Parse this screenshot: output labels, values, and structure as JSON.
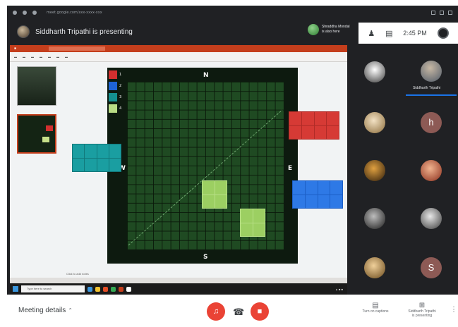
{
  "browser": {
    "url": "meet.google.com/xxx-xxxx-xxx"
  },
  "header": {
    "presenting_text": "Siddharth Tripathi is presenting",
    "joiner_line1": "Shraddha Mondal",
    "joiner_line2": "is also here",
    "time": "2:45 PM",
    "people_icon": "people-icon",
    "chat_icon": "chat-icon"
  },
  "slide": {
    "compass": {
      "n": "N",
      "s": "S",
      "w": "W",
      "e": "E"
    },
    "legend": [
      {
        "label": "1",
        "color": "#d32f2f"
      },
      {
        "label": "2",
        "color": "#1e63d6"
      },
      {
        "label": "3",
        "color": "#14908f"
      },
      {
        "label": "4",
        "color": "#b9dc85"
      }
    ],
    "notes": "Click to add notes"
  },
  "participants": [
    {
      "name": "",
      "color": "#b8b8b8"
    },
    {
      "name": "Siddharth Tripathi",
      "color": "#7a8898"
    },
    {
      "name": "",
      "color": "#e0c79a"
    },
    {
      "name": "",
      "letter": "h",
      "color": "#8d5a55"
    },
    {
      "name": "",
      "color": "#8a5a20"
    },
    {
      "name": "",
      "color": "#c9563e"
    },
    {
      "name": "",
      "color": "#666666"
    },
    {
      "name": "",
      "color": "#b6b6b6"
    },
    {
      "name": "",
      "color": "#c9a065"
    },
    {
      "name": "",
      "letter": "S",
      "color": "#8d5a55"
    }
  ],
  "bottom": {
    "meeting_details": "Meeting details",
    "captions_label": "Turn on captions",
    "presenting_label_1": "Siddharth Tripathi",
    "presenting_label_2": "is presenting"
  },
  "taskbar": {
    "search_placeholder": "Type here to search"
  }
}
